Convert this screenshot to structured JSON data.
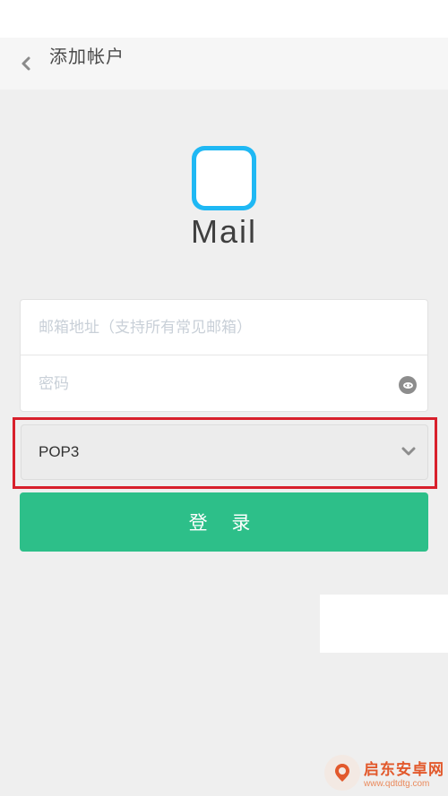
{
  "header": {
    "back_icon": "chevron-left-icon",
    "title": "添加帐户"
  },
  "brand": {
    "logo_icon": "mail-app-icon",
    "logo_color": "#1fb8f4",
    "app_name": "Mail"
  },
  "form": {
    "email_placeholder": "邮箱地址（支持所有常见邮箱）",
    "email_value": "",
    "password_placeholder": "密码",
    "password_value": "",
    "password_toggle_icon": "eye-icon",
    "protocol_selected": "POP3",
    "protocol_icon": "chevron-down-icon",
    "highlight_color": "#d8202c"
  },
  "actions": {
    "login_label": "登 录",
    "login_color": "#2dbf89"
  },
  "watermark": {
    "name": "启东安卓网",
    "url": "www.qdtdtg.com"
  }
}
